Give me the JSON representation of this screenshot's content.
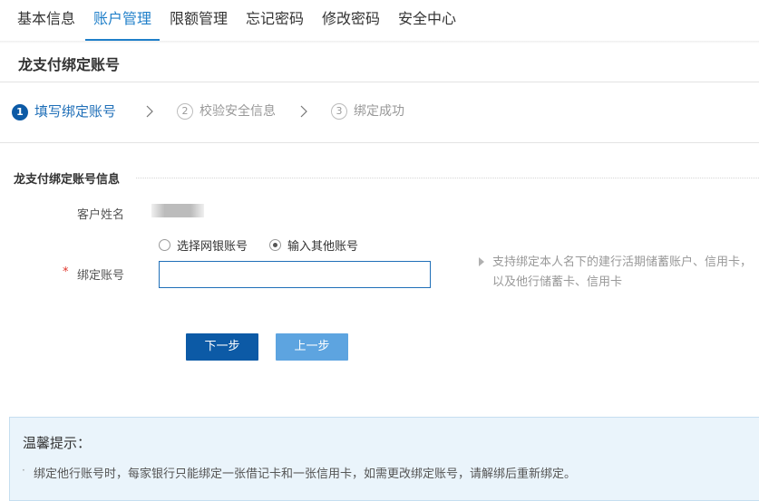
{
  "tabs": [
    {
      "label": "基本信息",
      "active": false
    },
    {
      "label": "账户管理",
      "active": true
    },
    {
      "label": "限额管理",
      "active": false
    },
    {
      "label": "忘记密码",
      "active": false
    },
    {
      "label": "修改密码",
      "active": false
    },
    {
      "label": "安全中心",
      "active": false
    }
  ],
  "page_title": "龙支付绑定账号",
  "steps": [
    {
      "num": "1",
      "label": "填写绑定账号",
      "active": true
    },
    {
      "num": "2",
      "label": "校验安全信息",
      "active": false
    },
    {
      "num": "3",
      "label": "绑定成功",
      "active": false
    }
  ],
  "form": {
    "section_title": "龙支付绑定账号信息",
    "customer_name_label": "客户姓名",
    "account_label": "绑定账号",
    "required_mark": "*",
    "radio_options": [
      {
        "label": "选择网银账号",
        "checked": false
      },
      {
        "label": "输入其他账号",
        "checked": true
      }
    ],
    "account_value": "",
    "hint": "支持绑定本人名下的建行活期储蓄账户、信用卡，以及他行储蓄卡、信用卡"
  },
  "buttons": {
    "next": "下一步",
    "prev": "上一步"
  },
  "tips": {
    "title": "温馨提示：",
    "items": [
      "绑定他行账号时，每家银行只能绑定一张借记卡和一张信用卡，如需更改绑定账号，请解绑后重新绑定。"
    ]
  },
  "colors": {
    "accent": "#1f7fc9",
    "primary_button": "#0c5aa6",
    "secondary_button": "#5da4e0",
    "tip_background": "#eaf4fb",
    "required": "#e0352b"
  }
}
